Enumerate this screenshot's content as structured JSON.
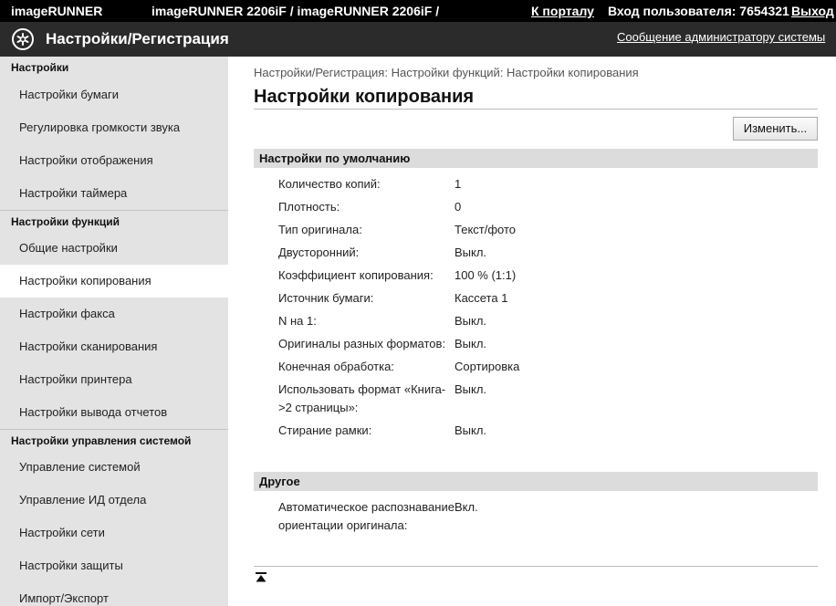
{
  "topbar": {
    "brand": "imageRUNNER",
    "model": "imageRUNNER 2206iF / imageRUNNER 2206iF /",
    "portal_link": "К порталу",
    "user_label": "Вход пользователя: 7654321",
    "logout_link": "Выход"
  },
  "titlebar": {
    "title": "Настройки/Регистрация",
    "admin_message_link": "Сообщение администратору системы",
    "logo_icon": "settings-logo-icon"
  },
  "sidebar": {
    "groups": [
      {
        "header": "Настройки",
        "items": [
          "Настройки бумаги",
          "Регулировка громкости звука",
          "Настройки отображения",
          "Настройки таймера"
        ]
      },
      {
        "header": "Настройки функций",
        "items": [
          "Общие настройки",
          "Настройки копирования",
          "Настройки факса",
          "Настройки сканирования",
          "Настройки принтера",
          "Настройки вывода отчетов"
        ]
      },
      {
        "header": "Настройки управления системой",
        "items": [
          "Управление системой",
          "Управление ИД отдела",
          "Настройки сети",
          "Настройки защиты",
          "Импорт/Экспорт"
        ]
      }
    ],
    "active_item": "Настройки копирования"
  },
  "main": {
    "breadcrumb": "Настройки/Регистрация: Настройки функций: Настройки копирования",
    "title": "Настройки копирования",
    "edit_button": "Изменить...",
    "sections": [
      {
        "title": "Настройки по умолчанию",
        "rows": [
          {
            "label": "Количество копий:",
            "value": "1"
          },
          {
            "label": "Плотность:",
            "value": "0"
          },
          {
            "label": "Тип оригинала:",
            "value": "Текст/фото"
          },
          {
            "label": "Двусторонний:",
            "value": "Выкл."
          },
          {
            "label": "Коэффициент копирования:",
            "value": "100 % (1:1)"
          },
          {
            "label": "Источник бумаги:",
            "value": "Кассета 1"
          },
          {
            "label": "N на 1:",
            "value": "Выкл."
          },
          {
            "label": "Оригиналы разных форматов:",
            "value": "Выкл."
          },
          {
            "label": "Конечная обработка:",
            "value": "Сортировка"
          },
          {
            "label": "Использовать формат «Книга->2 страницы»:",
            "value": "Выкл."
          },
          {
            "label": "Стирание рамки:",
            "value": "Выкл."
          }
        ]
      },
      {
        "title": "Другое",
        "rows": [
          {
            "label": "Автоматическое распознавание ориентации оригинала:",
            "value": "Вкл."
          }
        ]
      }
    ],
    "to_top_icon": "back-to-top-icon"
  }
}
